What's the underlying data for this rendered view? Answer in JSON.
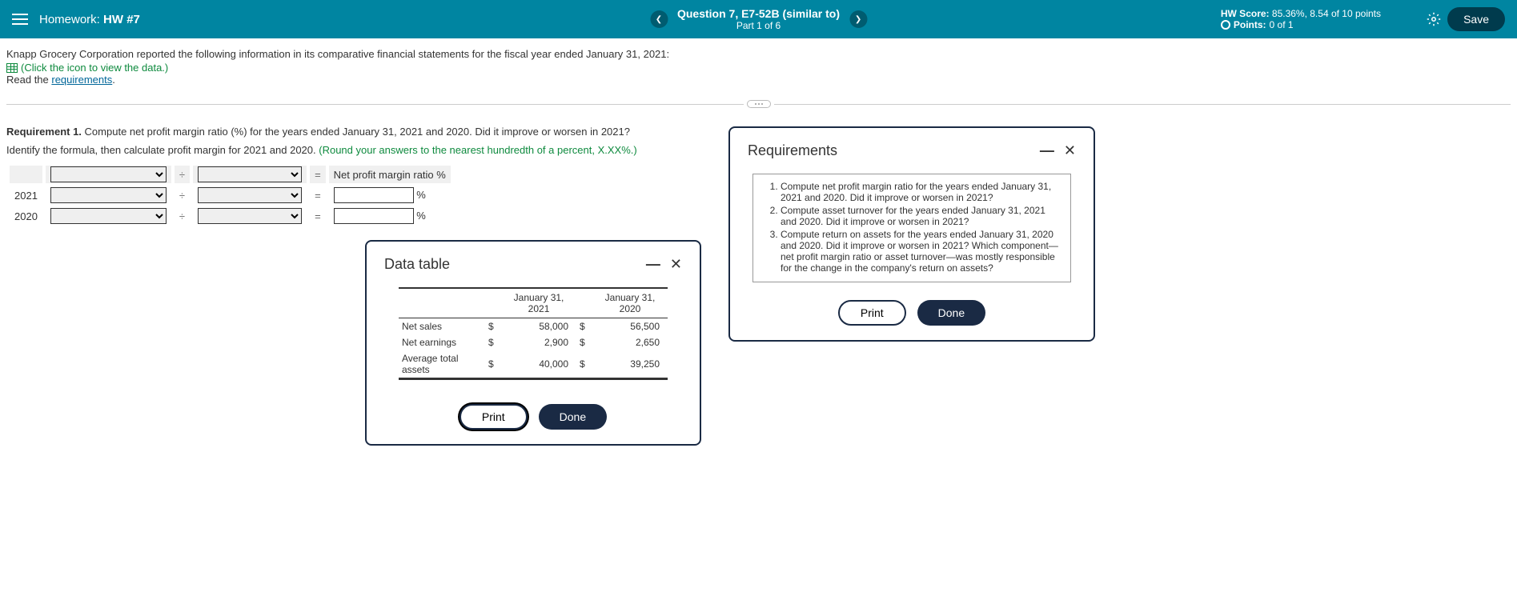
{
  "header": {
    "homework_label": "Homework:",
    "homework_name": "HW #7",
    "question_title": "Question 7, E7-52B (similar to)",
    "part": "Part 1 of 6",
    "hw_score_label": "HW Score:",
    "hw_score_value": "85.36%, 8.54 of 10 points",
    "points_label": "Points:",
    "points_value": "0 of 1",
    "save": "Save"
  },
  "intro": {
    "line1": "Knapp Grocery Corporation reported the following information in its comparative financial statements for the fiscal year ended January 31, 2021:",
    "data_link": "(Click the icon to view the data.)",
    "read": "Read the ",
    "req_link": "requirements"
  },
  "req1": {
    "label": "Requirement 1.",
    "text": "Compute net profit margin ratio (%) for the years ended January 31, 2021 and 2020. Did it improve or worsen in 2021?",
    "instruct": "Identify the formula, then calculate profit margin for 2021 and 2020.",
    "hint": "(Round your answers to the nearest hundredth of a percent, X.XX%.)"
  },
  "formula": {
    "result_label": "Net profit margin ratio %",
    "row1": "2021",
    "row2": "2020",
    "pct": "%",
    "divide": "÷",
    "equals": "="
  },
  "data_table": {
    "title": "Data table",
    "col1": "January 31, 2021",
    "col2": "January 31, 2020",
    "rows": [
      {
        "label": "Net sales",
        "v2021": "58,000",
        "v2020": "56,500"
      },
      {
        "label": "Net earnings",
        "v2021": "2,900",
        "v2020": "2,650"
      },
      {
        "label": "Average total assets",
        "v2021": "40,000",
        "v2020": "39,250"
      }
    ],
    "currency": "$",
    "print": "Print",
    "done": "Done"
  },
  "chart_data": {
    "type": "table",
    "title": "Data table",
    "columns": [
      "",
      "January 31, 2021",
      "January 31, 2020"
    ],
    "rows": [
      [
        "Net sales",
        58000,
        56500
      ],
      [
        "Net earnings",
        2900,
        2650
      ],
      [
        "Average total assets",
        40000,
        39250
      ]
    ]
  },
  "requirements": {
    "title": "Requirements",
    "items": [
      "Compute net profit margin ratio for the years ended January 31, 2021 and 2020. Did it improve or worsen in 2021?",
      "Compute asset turnover for the years ended January 31, 2021 and 2020. Did it improve or worsen in 2021?",
      "Compute return on assets for the years ended January 31, 2020 and 2020. Did it improve or worsen in 2021? Which component—net profit margin ratio or asset turnover—was mostly responsible for the change in the company's return on assets?"
    ],
    "print": "Print",
    "done": "Done"
  }
}
